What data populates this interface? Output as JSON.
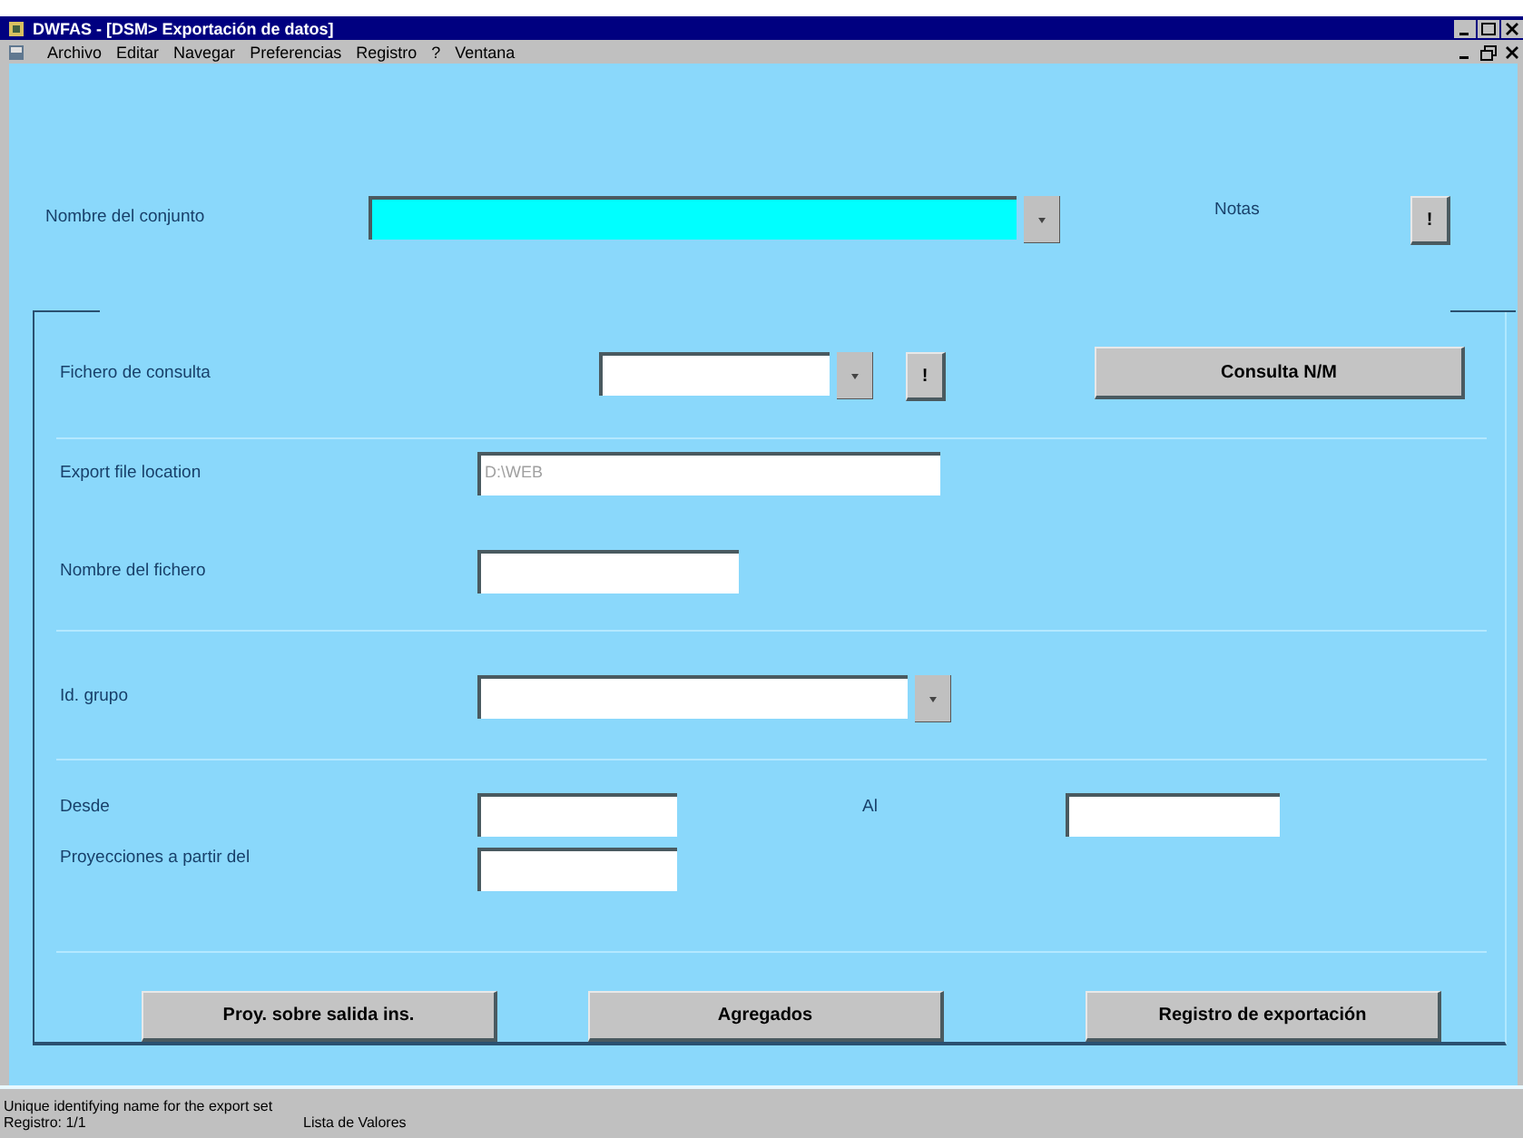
{
  "window": {
    "title": "DWFAS - [DSM> Exportación de datos]"
  },
  "menu": [
    "Archivo",
    "Editar",
    "Navegar",
    "Preferencias",
    "Registro",
    "?",
    "Ventana"
  ],
  "set_name": {
    "label": "Nombre del conjunto",
    "focused": true
  },
  "notes": {
    "label": "Notas",
    "button": "!"
  },
  "query_file": {
    "label": "Fichero de consulta",
    "button": "!",
    "action": "Consulta N/M"
  },
  "export_location": {
    "label": "Export file location",
    "value": "D:\\WEB",
    "disabled": true
  },
  "file_name": {
    "label": "Nombre del fichero"
  },
  "group_id": {
    "label": "Id. grupo"
  },
  "from": {
    "label": "Desde"
  },
  "to": {
    "label": "Al"
  },
  "projections": {
    "label": "Proyecciones a partir del"
  },
  "buttons": [
    "Proy. sobre salida ins.",
    "Agregados",
    "Registro de exportación"
  ],
  "status_bar": {
    "message": "Unique identifying name for the export set",
    "record": "Registro: 1/1",
    "mode": "Lista de Valores"
  }
}
